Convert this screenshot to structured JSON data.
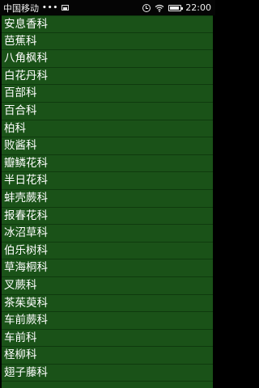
{
  "status_bar": {
    "carrier": "中国移动",
    "more_dots": "•••",
    "image_notification_icon": "image-icon",
    "alarm_icon": "alarm-clock-icon",
    "wifi_icon": "wifi-icon",
    "battery_icon": "battery-icon",
    "battery_level": 0.9,
    "time": "22:00"
  },
  "list": {
    "background_color": "#1a5218",
    "items": [
      "安息香科",
      "芭蕉科",
      "八角枫科",
      "白花丹科",
      "百部科",
      "百合科",
      "柏科",
      "败酱科",
      "瓣鳞花科",
      "半日花科",
      "蚌壳蕨科",
      "报春花科",
      "冰沼草科",
      "伯乐树科",
      "草海桐科",
      "叉蕨科",
      "茶茱萸科",
      "车前蕨科",
      "车前科",
      "柽柳科",
      "翅子藤科"
    ]
  }
}
